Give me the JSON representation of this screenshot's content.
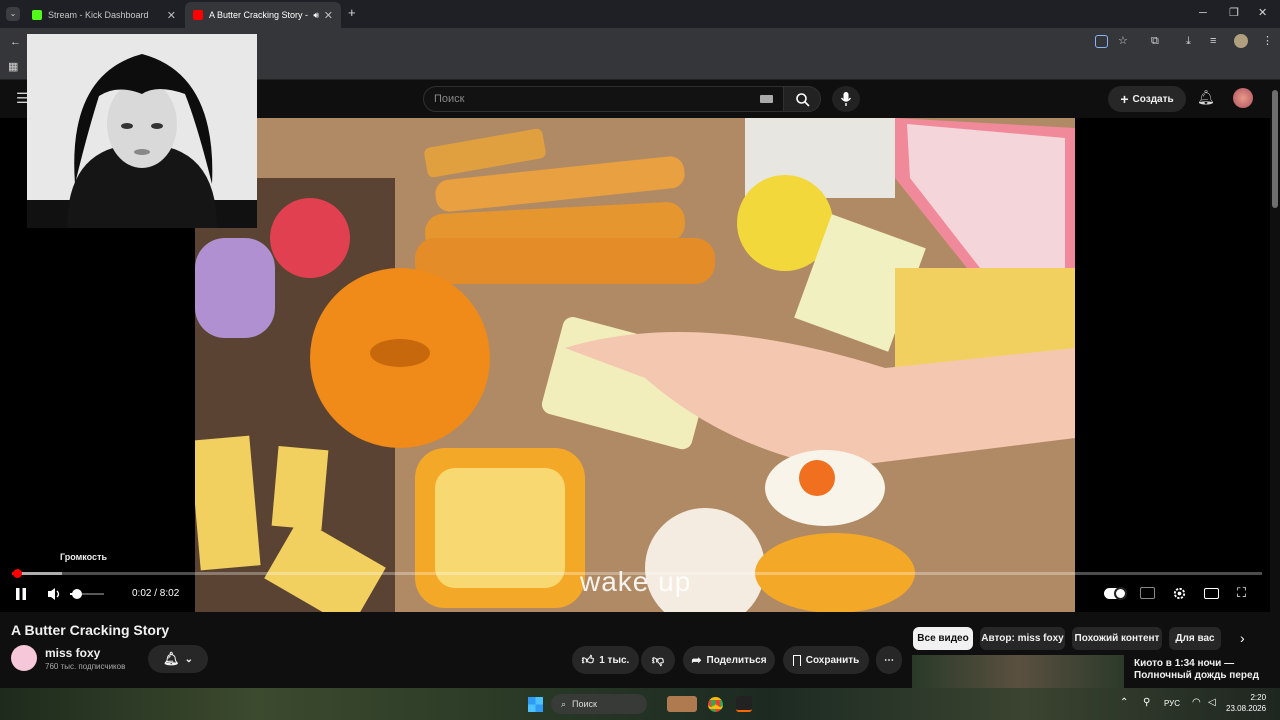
{
  "browser": {
    "tabs": [
      {
        "title": "Stream - Kick Dashboard",
        "active": false,
        "favicon_color": "#53fc18"
      },
      {
        "title": "A Butter Cracking Story - Yo",
        "active": true,
        "favicon_color": "#ff0000"
      }
    ],
    "new_tab_symbol": "+"
  },
  "youtube": {
    "search_placeholder": "Поиск",
    "create_label": "Создать",
    "video": {
      "title": "A Butter Cracking Story",
      "time_display": "0:02 / 8:02",
      "played_fraction": 0.0042,
      "buffered_fraction": 0.04,
      "volume_tooltip": "Громкость",
      "volume_fraction": 0.2,
      "caption": "wake up",
      "autoplay_on": true
    },
    "channel": {
      "name": "miss foxy",
      "subscribers": "760 тыс. подписчиков"
    },
    "actions": {
      "likes": "1 тыс.",
      "share": "Поделиться",
      "save": "Сохранить"
    },
    "chips": [
      "Все видео",
      "Автор: miss foxy",
      "Похожий контент",
      "Для вас"
    ],
    "recommendation_title": "Киото в 1:34 ночи — Полночный дождь перед"
  },
  "taskbar": {
    "search_label": "Поиск",
    "language": "РУС",
    "time": "2:20",
    "date": "23.08.2026"
  }
}
